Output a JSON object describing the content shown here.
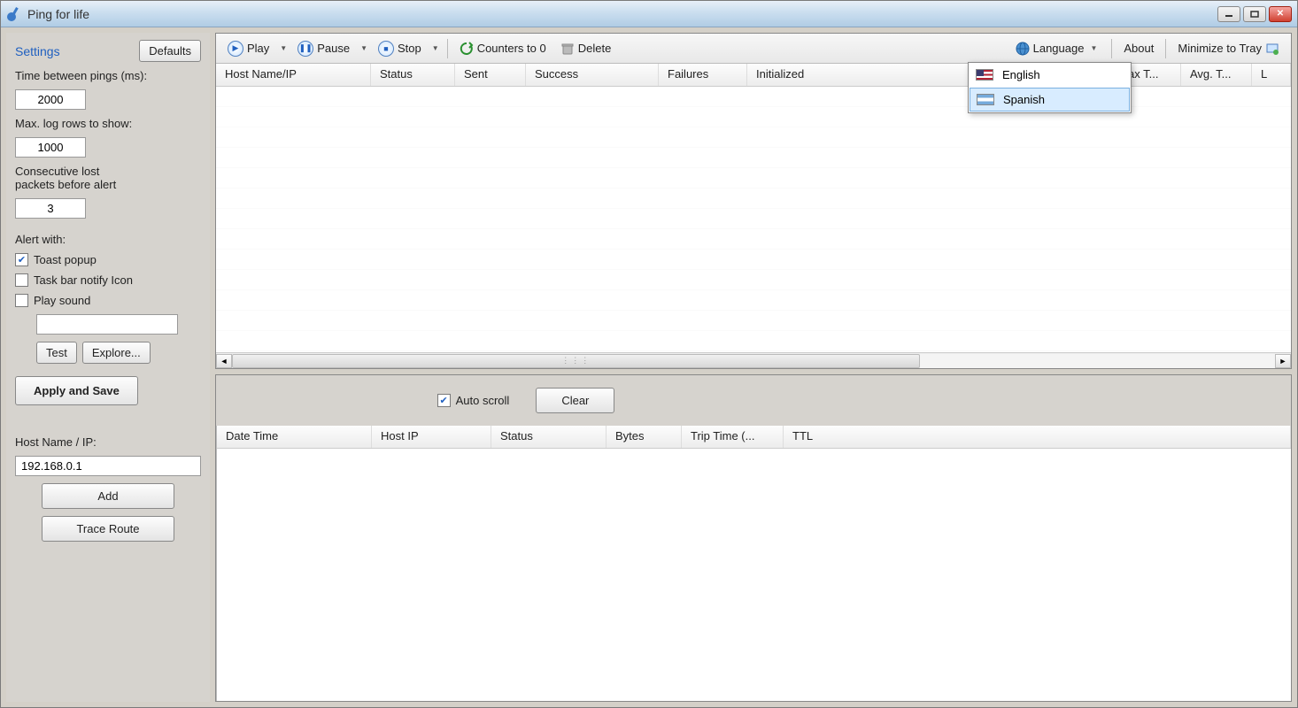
{
  "title": "Ping for life",
  "sidebar": {
    "heading": "Settings",
    "defaults": "Defaults",
    "time_label": "Time between pings (ms):",
    "time_value": "2000",
    "maxlog_label": "Max. log rows to show:",
    "maxlog_value": "1000",
    "lost_label1": "Consecutive lost",
    "lost_label2": "packets before alert",
    "lost_value": "3",
    "alert_with": "Alert with:",
    "toast": "Toast popup",
    "taskbar": "Task bar notify Icon",
    "playsound": "Play sound",
    "test": "Test",
    "explore": "Explore...",
    "apply": "Apply and Save",
    "host_label": "Host Name / IP:",
    "host_value": "192.168.0.1",
    "add": "Add",
    "trace": "Trace Route"
  },
  "toolbar": {
    "play": "Play",
    "pause": "Pause",
    "stop": "Stop",
    "counters": "Counters to 0",
    "delete": "Delete",
    "language": "Language",
    "about": "About",
    "minimize": "Minimize to Tray"
  },
  "lang_menu": {
    "english": "English",
    "spanish": "Spanish"
  },
  "hosts_cols": {
    "c0": "Host Name/IP",
    "c1": "Status",
    "c2": "Sent",
    "c3": "Success",
    "c4": "Failures",
    "c5": "Initialized",
    "c6": "ax T...",
    "c7": "Avg. T...",
    "c8": "L"
  },
  "log_cols": {
    "c0": "Date Time",
    "c1": "Host IP",
    "c2": "Status",
    "c3": "Bytes",
    "c4": "Trip Time (...",
    "c5": "TTL"
  },
  "bottom": {
    "autoscroll": "Auto scroll",
    "clear": "Clear"
  }
}
